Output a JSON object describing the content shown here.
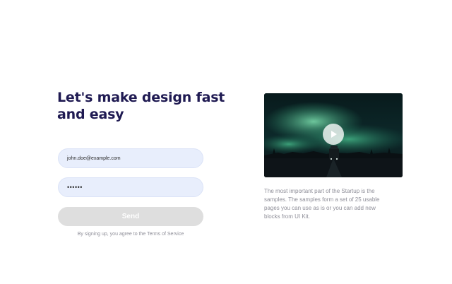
{
  "signup": {
    "headline": "Let's make design fast and easy",
    "email_value": "john.doe@example.com",
    "password_value": "••••••",
    "send_label": "Send",
    "terms_text": "By signing up, you agree to the Terms of Service"
  },
  "media": {
    "description": "The most important part of the Startup is the samples. The samples form a set of 25 usable pages you can use as is or you can add new blocks from UI Kit."
  },
  "icons": {
    "play": "play-icon"
  }
}
